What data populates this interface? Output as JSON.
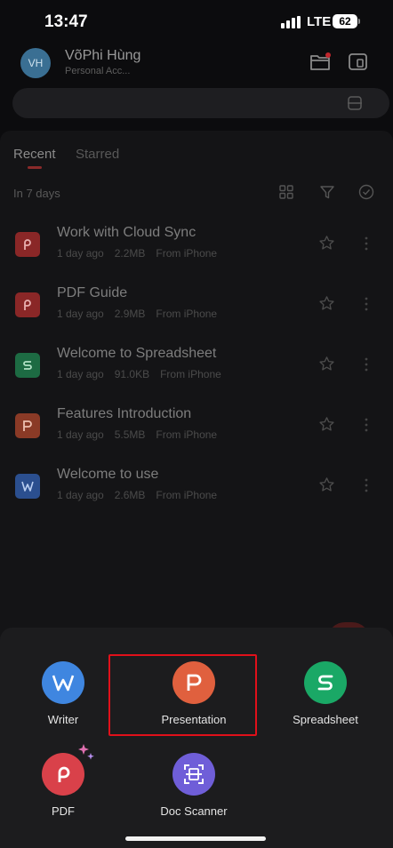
{
  "status_bar": {
    "time": "13:47",
    "network": "LTE",
    "battery": "62"
  },
  "header": {
    "avatar_initials": "VH",
    "user_name": "VõPhi Hùng",
    "account_type": "Personal Acc..."
  },
  "tabs": [
    {
      "label": "Recent"
    },
    {
      "label": "Starred"
    }
  ],
  "section_label": "In 7 days",
  "files": [
    {
      "name": "Work with Cloud Sync",
      "age": "1 day ago",
      "size": "2.2MB",
      "source": "From iPhone",
      "type": "pdf",
      "color": "#8a2727"
    },
    {
      "name": "PDF Guide",
      "age": "1 day ago",
      "size": "2.9MB",
      "source": "From iPhone",
      "type": "pdf",
      "color": "#8a2727"
    },
    {
      "name": "Welcome to Spreadsheet",
      "age": "1 day ago",
      "size": "91.0KB",
      "source": "From iPhone",
      "type": "spreadsheet",
      "color": "#1d6b43"
    },
    {
      "name": "Features Introduction",
      "age": "1 day ago",
      "size": "5.5MB",
      "source": "From iPhone",
      "type": "presentation",
      "color": "#8a3a26"
    },
    {
      "name": "Welcome to use",
      "age": "1 day ago",
      "size": "2.6MB",
      "source": "From iPhone",
      "type": "writer",
      "color": "#2b4f8f"
    }
  ],
  "create_menu": [
    {
      "label": "Writer",
      "icon": "writer-icon",
      "color": "#3f86e0"
    },
    {
      "label": "Presentation",
      "icon": "presentation-icon",
      "color": "#e0603e"
    },
    {
      "label": "Spreadsheet",
      "icon": "spreadsheet-icon",
      "color": "#1aa866"
    },
    {
      "label": "PDF",
      "icon": "pdf-icon",
      "color": "#d9414a"
    },
    {
      "label": "Doc Scanner",
      "icon": "doc-scanner-icon",
      "color": "#6f5ed8"
    }
  ]
}
